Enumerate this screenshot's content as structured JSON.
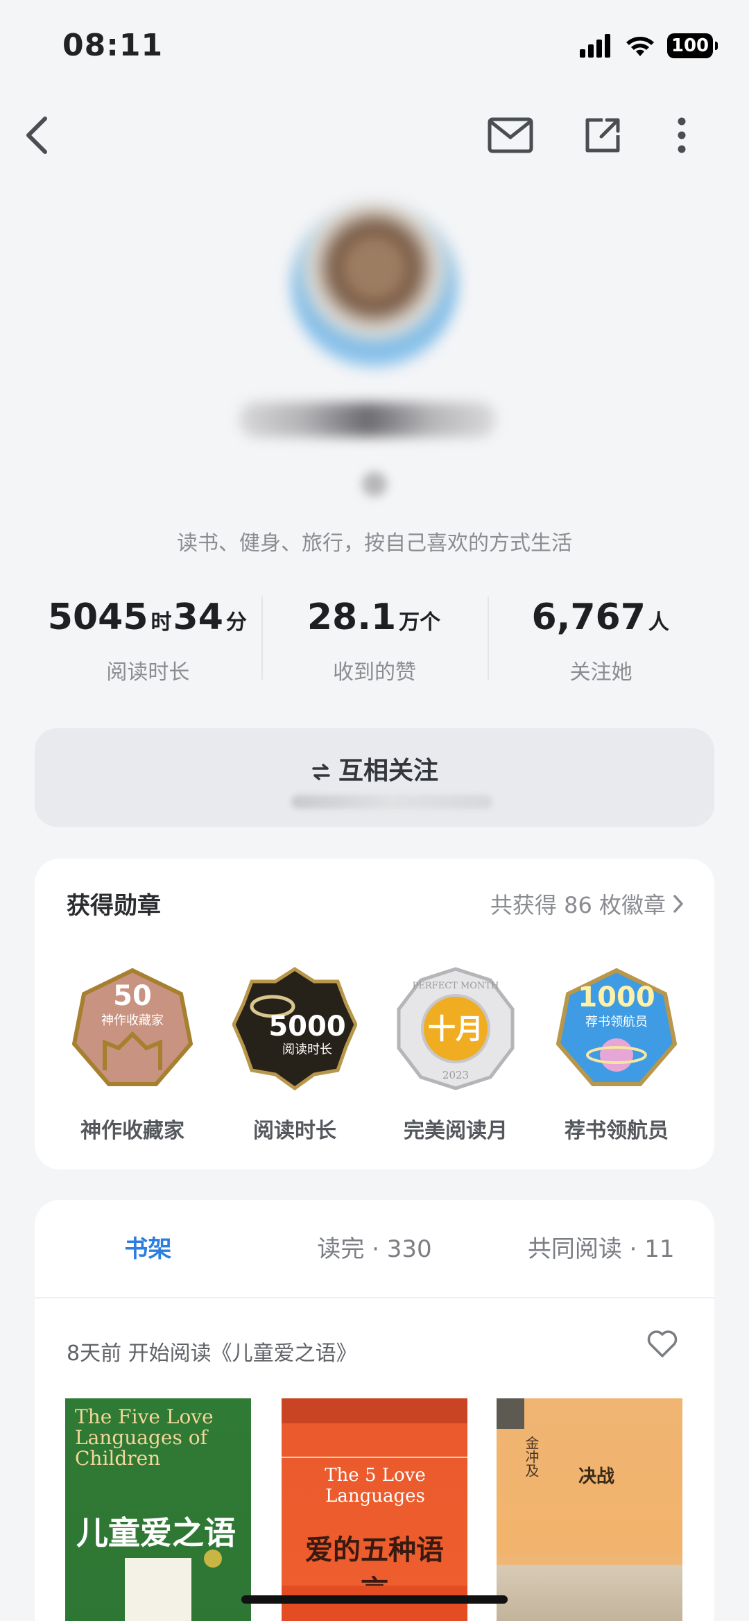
{
  "status_bar": {
    "time": "08:11",
    "battery": "100"
  },
  "profile": {
    "bio": "读书、健身、旅行，按自己喜欢的方式生活"
  },
  "stats": [
    {
      "v1": "5045",
      "u1": "时",
      "v2": "34",
      "u2": "分",
      "label": "阅读时长"
    },
    {
      "v1": "28.1",
      "u1": "万个",
      "label": "收到的赞"
    },
    {
      "v1": "6,767",
      "u1": "人",
      "label": "关注她"
    }
  ],
  "follow": {
    "label": "互相关注"
  },
  "badges": {
    "title": "获得勋章",
    "more": "共获得 86 枚徽章",
    "items": [
      {
        "label": "神作收藏家",
        "art_number": "50",
        "art_text": "神作收藏家",
        "color": "#c99483"
      },
      {
        "label": "阅读时长",
        "art_number": "5000",
        "art_text": "阅读时长",
        "color": "#2a261d"
      },
      {
        "label": "完美阅读月",
        "art_number": "十月",
        "art_text": "PERFECT MONTH",
        "art_year": "2023",
        "color": "#e8a92c"
      },
      {
        "label": "荐书领航员",
        "art_number": "1000",
        "art_text": "荐书领航员",
        "color": "#3f9be3"
      }
    ]
  },
  "shelf": {
    "tabs": [
      {
        "label": "书架"
      },
      {
        "label": "读完 · 330"
      },
      {
        "label": "共同阅读 · 11"
      }
    ],
    "activity": "8天前 开始阅读《儿童爱之语》",
    "books": [
      {
        "en_title": "The Five Love Languages of Children",
        "cn_title": "儿童爱之语"
      },
      {
        "en_title": "The 5 Love Languages",
        "cn_title": "爱的五种语言"
      },
      {
        "author": "金冲及",
        "cn_title": "决战"
      }
    ]
  }
}
